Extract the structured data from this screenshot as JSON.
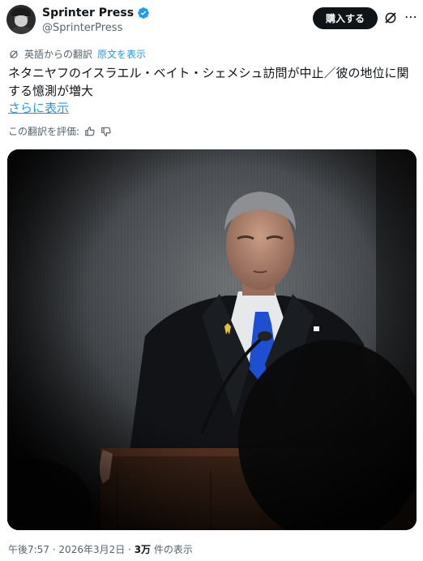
{
  "header": {
    "display_name": "Sprinter Press",
    "handle": "@SprinterPress",
    "buy_label": "購入する"
  },
  "translation": {
    "label": "英語からの翻訳",
    "original_link": "原文を表示"
  },
  "post": {
    "text": "ネタニヤフのイスラエル・ベイト・シェメシュ訪問が中止／彼の地位に関する憶測が増大",
    "show_more": "さらに表示"
  },
  "rating": {
    "label": "この翻訳を評価:"
  },
  "meta": {
    "time": "午後7:57",
    "date": "2026年3月2日",
    "views_count": "3万",
    "views_suffix": "件の表示"
  },
  "icons": {
    "verified": "verified-badge-icon",
    "grok": "grok-icon",
    "more": "more-icon",
    "translate": "translate-icon",
    "thumbs_up": "thumbs-up-icon",
    "thumbs_down": "thumbs-down-icon"
  },
  "colors": {
    "accent": "#1d9bf0",
    "text": "#0f1419",
    "muted": "#536471",
    "button_bg": "#0f1419"
  }
}
